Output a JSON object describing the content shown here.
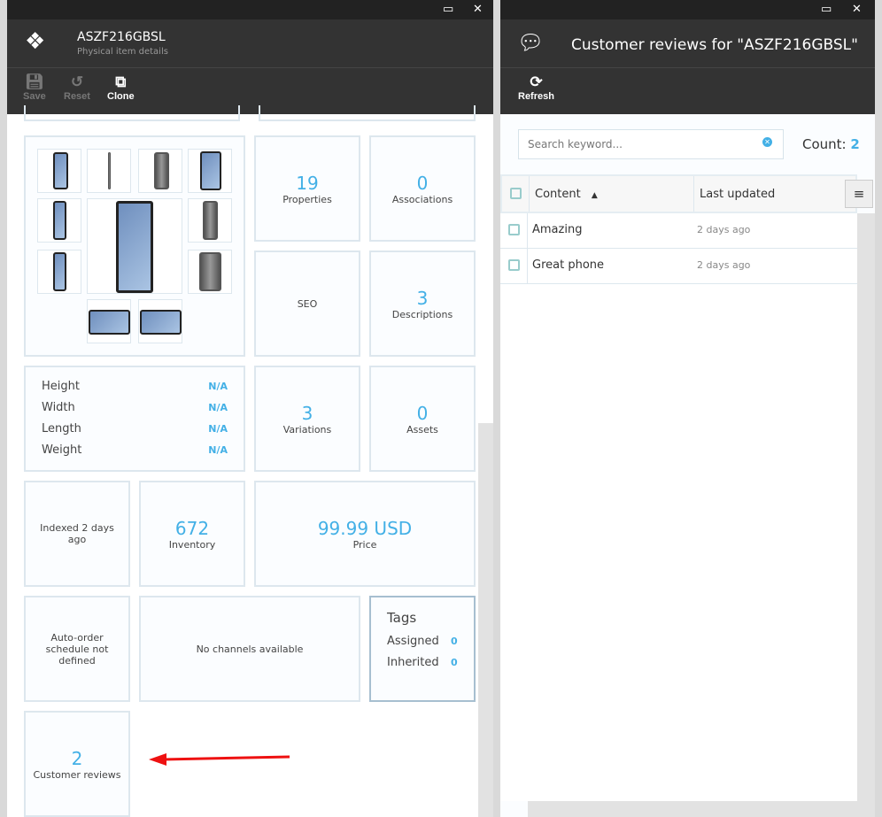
{
  "left": {
    "title": "ASZF216GBSL",
    "subtitle": "Physical item details",
    "toolbar": {
      "save": "Save",
      "reset": "Reset",
      "clone": "Clone"
    },
    "tiles": {
      "properties": {
        "value": "19",
        "label": "Properties"
      },
      "associations": {
        "value": "0",
        "label": "Associations"
      },
      "seo": {
        "label": "SEO"
      },
      "descriptions": {
        "value": "3",
        "label": "Descriptions"
      },
      "dimensions": [
        {
          "label": "Height",
          "value": "N/A"
        },
        {
          "label": "Width",
          "value": "N/A"
        },
        {
          "label": "Length",
          "value": "N/A"
        },
        {
          "label": "Weight",
          "value": "N/A"
        }
      ],
      "variations": {
        "value": "3",
        "label": "Variations"
      },
      "assets": {
        "value": "0",
        "label": "Assets"
      },
      "indexed": {
        "label": "Indexed 2 days ago"
      },
      "inventory": {
        "value": "672",
        "label": "Inventory"
      },
      "price": {
        "value": "99.99 USD",
        "label": "Price"
      },
      "autoorder": {
        "label": "Auto-order schedule not defined"
      },
      "channels": {
        "label": "No channels available"
      },
      "tags": {
        "title": "Tags",
        "assigned_label": "Assigned",
        "assigned": "0",
        "inherited_label": "Inherited",
        "inherited": "0"
      },
      "reviews": {
        "value": "2",
        "label": "Customer reviews"
      }
    }
  },
  "right": {
    "title": "Customer reviews for \"ASZF216GBSL\"",
    "toolbar": {
      "refresh": "Refresh"
    },
    "search_placeholder": "Search keyword...",
    "count_label": "Count:",
    "count": "2",
    "columns": [
      "Content",
      "Last updated"
    ],
    "rows": [
      {
        "content": "Amazing",
        "updated": "2 days ago"
      },
      {
        "content": "Great phone",
        "updated": "2 days ago"
      }
    ]
  },
  "colors": {
    "accent": "#43b0e6",
    "annotation_arrow": "#ee1111"
  }
}
